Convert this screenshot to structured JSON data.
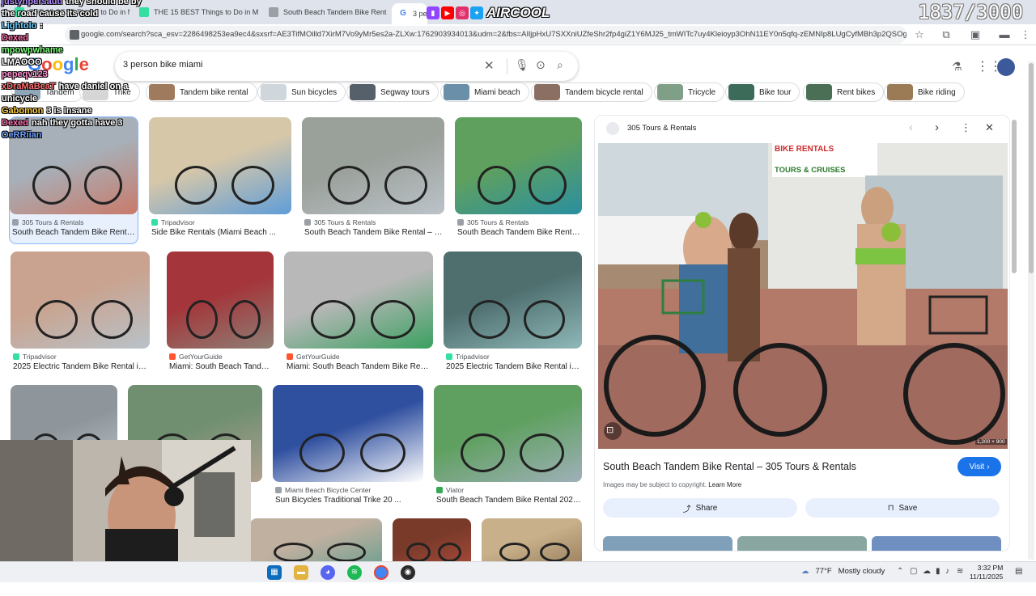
{
  "browser": {
    "tabs": [
      {
        "label": "THE 15 BEST Things to Do in M",
        "favicon_color": "#34e0a1"
      },
      {
        "label": "THE 15 BEST Things to Do in M",
        "favicon_color": "#34e0a1"
      },
      {
        "label": "South Beach Tandem Bike Rent",
        "favicon_color": "#9aa0a6"
      },
      {
        "label": "3 pers",
        "favicon_color": "#4285f4"
      }
    ],
    "url": "google.com/search?sca_esv=2286498253ea9ec4&sxsrf=AE3TifMOilld7XirM7Vo9yMr5es2a-ZLXw:1762903934013&udm=2&fbs=AIljpHxU7SXXniUZfeShr2fp4giZ1Y6MJ25_tmWITc7uy4Kleioyp3OhN11EY0n5qfq-zEMNIp8LUgCyfMBh3p2QSOggsatzn..."
  },
  "search": {
    "query": "3 person bike miami",
    "google_letters": [
      "G",
      "o",
      "o",
      "g",
      "l",
      "e"
    ],
    "google_colors": [
      "#4285f4",
      "#ea4335",
      "#fbbc05",
      "#4285f4",
      "#34a853",
      "#ea4335"
    ]
  },
  "chips": [
    {
      "label": "Tandem",
      "thumb": "#8fa5b8"
    },
    {
      "label": "Trike",
      "thumb": "#d6d6d6"
    },
    {
      "label": "Tandem bike rental",
      "thumb": "#a07a5c"
    },
    {
      "label": "Sun bicycles",
      "thumb": "#cfd6dc"
    },
    {
      "label": "Segway tours",
      "thumb": "#55606b"
    },
    {
      "label": "Miami beach",
      "thumb": "#6a8fa8"
    },
    {
      "label": "Tandem bicycle rental",
      "thumb": "#8c6f63"
    },
    {
      "label": "Tricycle",
      "thumb": "#7f9f86"
    },
    {
      "label": "Bike tour",
      "thumb": "#3d6b5a"
    },
    {
      "label": "Rent bikes",
      "thumb": "#4a6f55"
    },
    {
      "label": "Bike riding",
      "thumb": "#9b7b55"
    }
  ],
  "results": [
    {
      "source": "305 Tours & Rentals",
      "caption": "South Beach Tandem Bike Rental ...",
      "src_color": "#9aa0a6",
      "c1": "#c97a6a",
      "c2": "#a7b0b8"
    },
    {
      "source": "Tripadvisor",
      "caption": "Side Bike Rentals (Miami Beach ...",
      "src_color": "#34e0a1",
      "c1": "#5f9dd8",
      "c2": "#d6c7a9"
    },
    {
      "source": "305 Tours & Rentals",
      "caption": "South Beach Tandem Bike Rental – 30...",
      "src_color": "#9aa0a6",
      "c1": "#bcc3c9",
      "c2": "#9aa09a"
    },
    {
      "source": "305 Tours & Rentals",
      "caption": "South Beach Tandem Bike Rental ...",
      "src_color": "#9aa0a6",
      "c1": "#2a8fa0",
      "c2": "#5fa05f"
    },
    {
      "source": "Tripadvisor",
      "caption": "2025 Electric Tandem Bike Rental in ...",
      "src_color": "#34e0a1",
      "c1": "#b9c2c9",
      "c2": "#c9a38f"
    },
    {
      "source": "GetYourGuide",
      "caption": "Miami: South Beach Tandem ...",
      "src_color": "#ff5533",
      "c1": "#8e7f75",
      "c2": "#a4353a"
    },
    {
      "source": "GetYourGuide",
      "caption": "Miami: South Beach Tandem Bike Rental...",
      "src_color": "#ff5533",
      "c1": "#3aa060",
      "c2": "#b8b8b8"
    },
    {
      "source": "Tripadvisor",
      "caption": "2025 Electric Tandem Bike Rental in ...",
      "src_color": "#34e0a1",
      "c1": "#8fb8b8",
      "c2": "#4f6f6f"
    },
    {
      "source": "",
      "caption": "",
      "src_color": "#9aa0a6",
      "c1": "#bfc7cc",
      "c2": "#8e969c"
    },
    {
      "source": "",
      "caption": "",
      "src_color": "#9aa0a6",
      "c1": "#b0a090",
      "c2": "#6f8f70"
    },
    {
      "source": "Miami Beach Bicycle Center",
      "caption": "Sun Bicycles Traditional Trike 20 ...",
      "src_color": "#9aa0a6",
      "c1": "#ffffff",
      "c2": "#2f4f9f"
    },
    {
      "source": "Viator",
      "caption": "South Beach Tandem Bike Rental 2025 ...",
      "src_color": "#34a853",
      "c1": "#9fb0b8",
      "c2": "#5fa060"
    },
    {
      "source": "",
      "caption": "",
      "src_color": "#9aa0a6",
      "c1": "#6fa090",
      "c2": "#c0b0a0"
    },
    {
      "source": "",
      "caption": "",
      "src_color": "#9aa0a6",
      "c1": "#a64a3a",
      "c2": "#7a3a2a"
    },
    {
      "source": "",
      "caption": "",
      "src_color": "#9aa0a6",
      "c1": "#9a7f5f",
      "c2": "#c8b08a"
    }
  ],
  "panel": {
    "source": "305 Tours & Rentals",
    "sign_line1": "BIKE RENTALS",
    "sign_line2": "TOURS & CRUISES",
    "image_size": "1,200 × 900",
    "title": "South Beach Tandem Bike Rental – 305 Tours & Rentals",
    "visit_label": "Visit",
    "copyright": "Images may be subject to copyright.",
    "learn_more": "Learn More",
    "share_label": "Share",
    "save_label": "Save"
  },
  "chat": [
    {
      "user": "justynpersaud",
      "text": "they should be by",
      "color": "#b48cff"
    },
    {
      "user": "",
      "text": "the road cause its cold",
      "color": "#ffffff"
    },
    {
      "user": "Lightolo",
      "text": ":",
      "color": "#6fd0ff"
    },
    {
      "user": "Dexed",
      "text": "",
      "color": "#ff6fb0"
    },
    {
      "user": "mpowpwhame",
      "text": "",
      "color": "#7fff7f"
    },
    {
      "user": "",
      "text": "LMAOOO",
      "color": "#ffffff"
    },
    {
      "user": "pepeqv123",
      "text": "",
      "color": "#ff8fd0"
    },
    {
      "user": "xDraMaBeaT",
      "text": "have daniel on a",
      "color": "#ff6f6f"
    },
    {
      "user": "",
      "text": "unicycle",
      "color": "#ffffff"
    },
    {
      "user": "Gabomon",
      "text": "3 is insane",
      "color": "#ffd040"
    },
    {
      "user": "Dexed",
      "text": "nah they gotta have 3",
      "color": "#ff6fb0"
    },
    {
      "user": "OeRRiian",
      "text": "",
      "color": "#6fa0ff"
    }
  ],
  "stream": {
    "brand": "AIRCOOL",
    "counter": "1837/3000"
  },
  "taskbar": {
    "temperature": "77°F",
    "weather": "Mostly cloudy",
    "time": "3:32 PM",
    "date": "11/11/2025"
  }
}
